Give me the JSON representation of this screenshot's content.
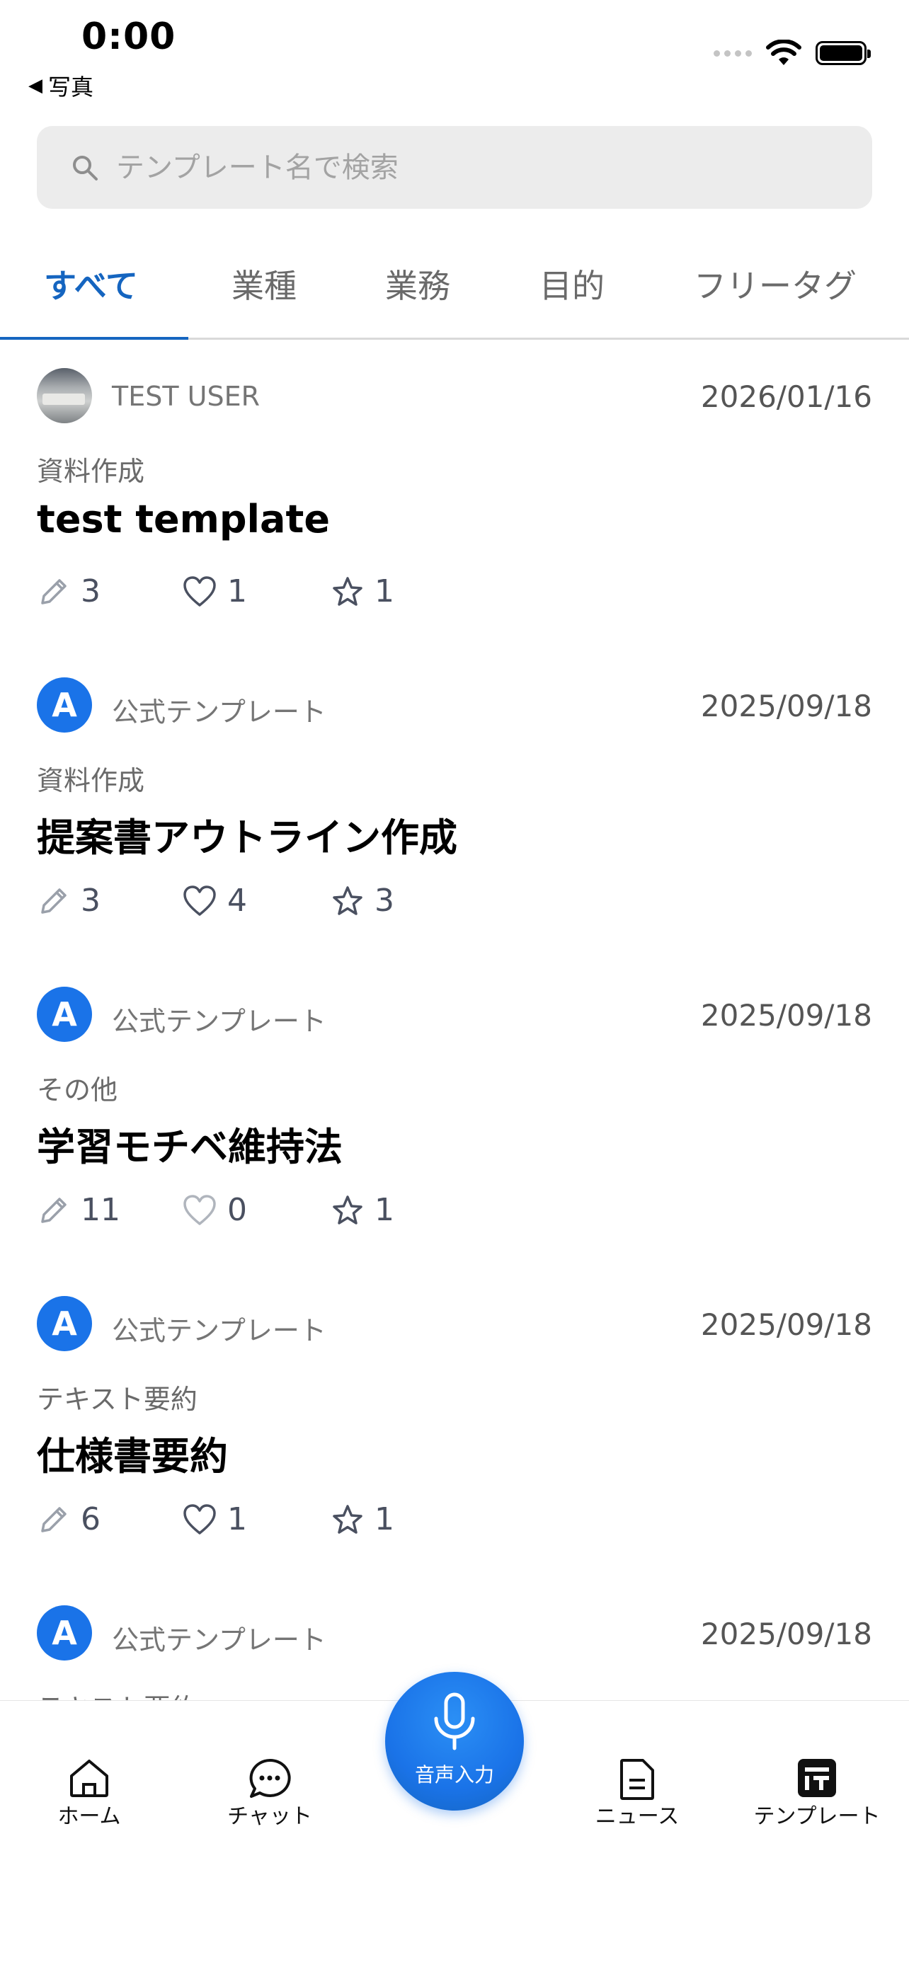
{
  "status_bar": {
    "time": "0:00",
    "back_app": "写真"
  },
  "search": {
    "placeholder": "テンプレート名で検索"
  },
  "tabs": [
    {
      "label": "すべて",
      "active": true
    },
    {
      "label": "業種",
      "active": false
    },
    {
      "label": "業務",
      "active": false
    },
    {
      "label": "目的",
      "active": false
    },
    {
      "label": "フリータグ",
      "active": false
    }
  ],
  "templates": [
    {
      "author": "TEST USER",
      "avatar": "user-photo",
      "date": "2026/01/16",
      "category": "資料作成",
      "title": "test template",
      "uses": "3",
      "likes": "1",
      "favorites": "1"
    },
    {
      "author": "公式テンプレート",
      "avatar": "official-logo",
      "date": "2025/09/18",
      "category": "資料作成",
      "title": "提案書アウトライン作成",
      "uses": "3",
      "likes": "4",
      "favorites": "3"
    },
    {
      "author": "公式テンプレート",
      "avatar": "official-logo",
      "date": "2025/09/18",
      "category": "その他",
      "title": "学習モチベ維持法",
      "uses": "11",
      "likes": "0",
      "favorites": "1"
    },
    {
      "author": "公式テンプレート",
      "avatar": "official-logo",
      "date": "2025/09/18",
      "category": "テキスト要約",
      "title": "仕様書要約",
      "uses": "6",
      "likes": "1",
      "favorites": "1"
    },
    {
      "author": "公式テンプレート",
      "avatar": "official-logo",
      "date": "2025/09/18",
      "category": "テキスト要約",
      "title": "",
      "uses": "",
      "likes": "",
      "favorites": ""
    }
  ],
  "official_logo_letter": "A",
  "bottom_nav": {
    "home": "ホーム",
    "chat": "チャット",
    "voice": "音声入力",
    "news": "ニュース",
    "template": "テンプレート"
  },
  "colors": {
    "accent": "#1565c0",
    "voice_button": "#1a73e8",
    "official_avatar": "#1a73e8"
  }
}
